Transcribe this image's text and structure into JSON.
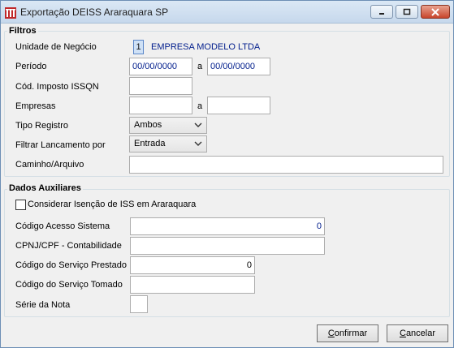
{
  "window": {
    "title": "Exportação DEISS Araraquara SP"
  },
  "filtros": {
    "title": "Filtros",
    "unidade_label": "Unidade de Negócio",
    "unidade_code": "1",
    "unidade_name": "EMPRESA MODELO LTDA",
    "periodo_label": "Período",
    "periodo_from": "00/00/0000",
    "periodo_sep": "a",
    "periodo_to": "00/00/0000",
    "cod_imposto_label": "Cód. Imposto ISSQN",
    "cod_imposto_value": "",
    "empresas_label": "Empresas",
    "empresas_from": "",
    "empresas_sep": "a",
    "empresas_to": "",
    "tipo_registro_label": "Tipo Registro",
    "tipo_registro_value": "Ambos",
    "filtrar_label": "Filtrar Lancamento por",
    "filtrar_value": "Entrada",
    "caminho_label": "Caminho/Arquivo",
    "caminho_value": ""
  },
  "dados": {
    "title": "Dados Auxiliares",
    "isencao_label": "Considerar Isenção de ISS em Araraquara",
    "isencao_checked": false,
    "acesso_label": "Código Acesso Sistema",
    "acesso_value": "0",
    "cpnj_label": "CPNJ/CPF - Contabilidade",
    "cpnj_value": "",
    "servico_prestado_label": "Código do Serviço Prestado",
    "servico_prestado_value": "0",
    "servico_tomado_label": "Código do Serviço Tomado",
    "servico_tomado_value": "",
    "serie_label": "Série da Nota",
    "serie_value": ""
  },
  "buttons": {
    "confirmar_accel": "C",
    "confirmar_rest": "onfirmar",
    "cancelar_accel": "C",
    "cancelar_rest": "ancelar"
  }
}
